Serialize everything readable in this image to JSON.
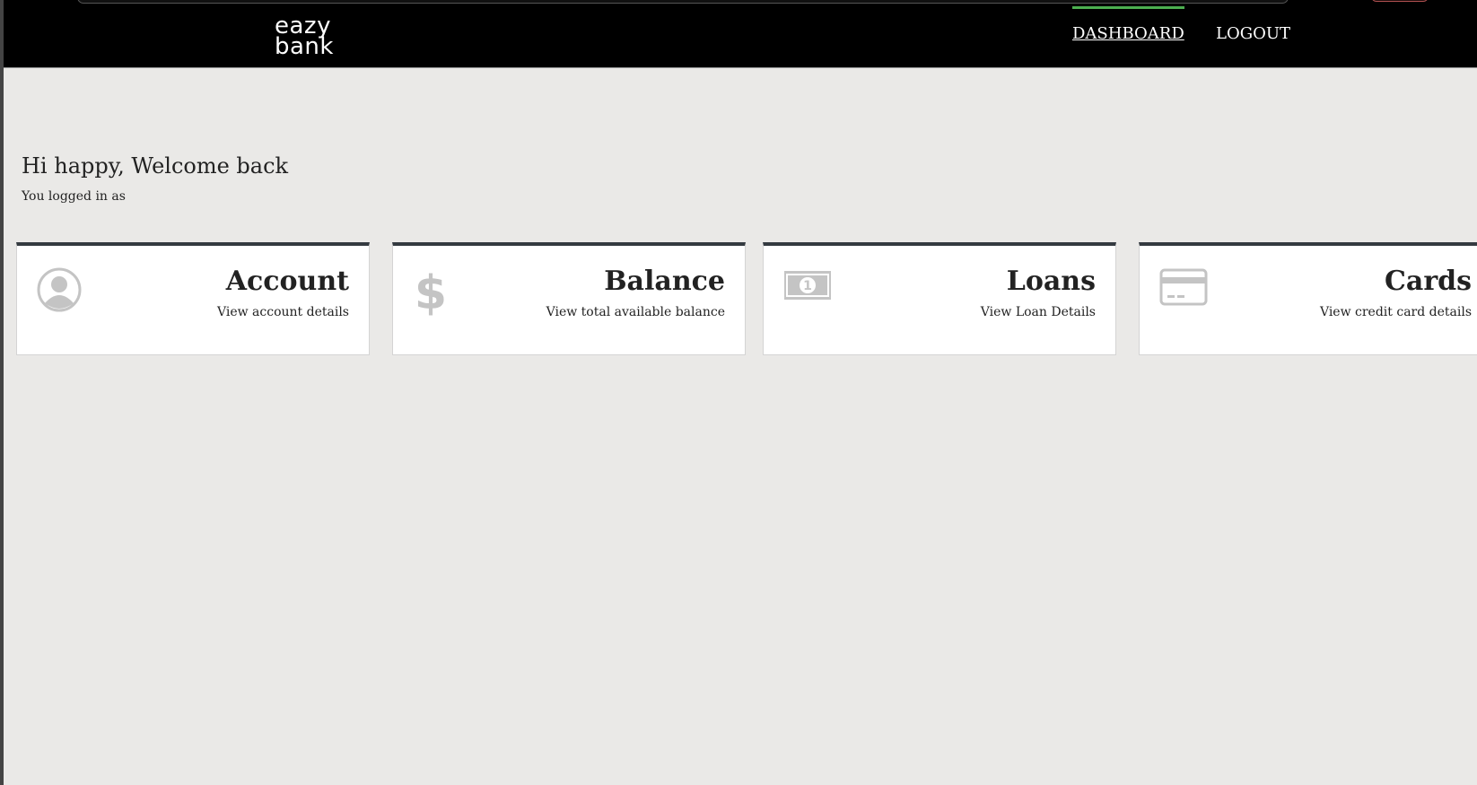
{
  "header": {
    "logo_line1": "eazy",
    "logo_line2": "bank",
    "nav": [
      {
        "label": "DASHBOARD",
        "active": true
      },
      {
        "label": "LOGOUT",
        "active": false
      }
    ]
  },
  "welcome": {
    "greeting": "Hi happy, Welcome back",
    "subtext": "You logged in as"
  },
  "cards": [
    {
      "title": "Account",
      "description": "View account details",
      "icon": "user-circle-icon"
    },
    {
      "title": "Balance",
      "description": "View total available balance",
      "icon": "dollar-icon"
    },
    {
      "title": "Loans",
      "description": "View Loan Details",
      "icon": "money-bill-icon"
    },
    {
      "title": "Cards",
      "description": "View credit card details",
      "icon": "credit-card-icon"
    }
  ],
  "colors": {
    "background": "#eae9e7",
    "header": "#000000",
    "active_nav_accent": "#4caf50",
    "card_top_border": "#343a40",
    "icon_gray": "#c4c4c4"
  }
}
